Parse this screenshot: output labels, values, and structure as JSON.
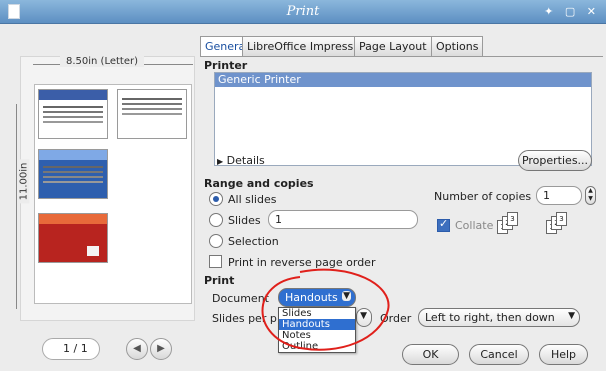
{
  "window": {
    "title": "Print",
    "controls": "✦ ▢ ✕"
  },
  "preview": {
    "paper_width": "8.50in (Letter)",
    "paper_height": "11.00in",
    "page_current": "1",
    "page_sep": "/",
    "page_total": "1"
  },
  "tabs": [
    "General",
    "LibreOffice Impress",
    "Page Layout",
    "Options"
  ],
  "printer": {
    "heading": "Printer",
    "selected": "Generic Printer",
    "details_label": "Details",
    "properties_label": "Properties..."
  },
  "range": {
    "heading": "Range and copies",
    "all_slides": "All slides",
    "slides": "Slides",
    "slides_value": "1",
    "selection": "Selection",
    "reverse": "Print in reverse page order",
    "copies_label": "Number of copies",
    "copies_value": "1",
    "collate": "Collate"
  },
  "print": {
    "heading": "Print",
    "document_label": "Document",
    "document_value": "Handouts",
    "slides_per_page_label": "Slides per p",
    "order_label": "Order",
    "order_value": "Left to right, then down",
    "options": [
      "Slides",
      "Handouts",
      "Notes",
      "Outline"
    ]
  },
  "buttons": {
    "ok": "OK",
    "cancel": "Cancel",
    "help": "Help"
  },
  "colors": {
    "accent": "#2f6fd0",
    "titlebar": "#6f9ccc",
    "annotation": "#e0201b"
  }
}
